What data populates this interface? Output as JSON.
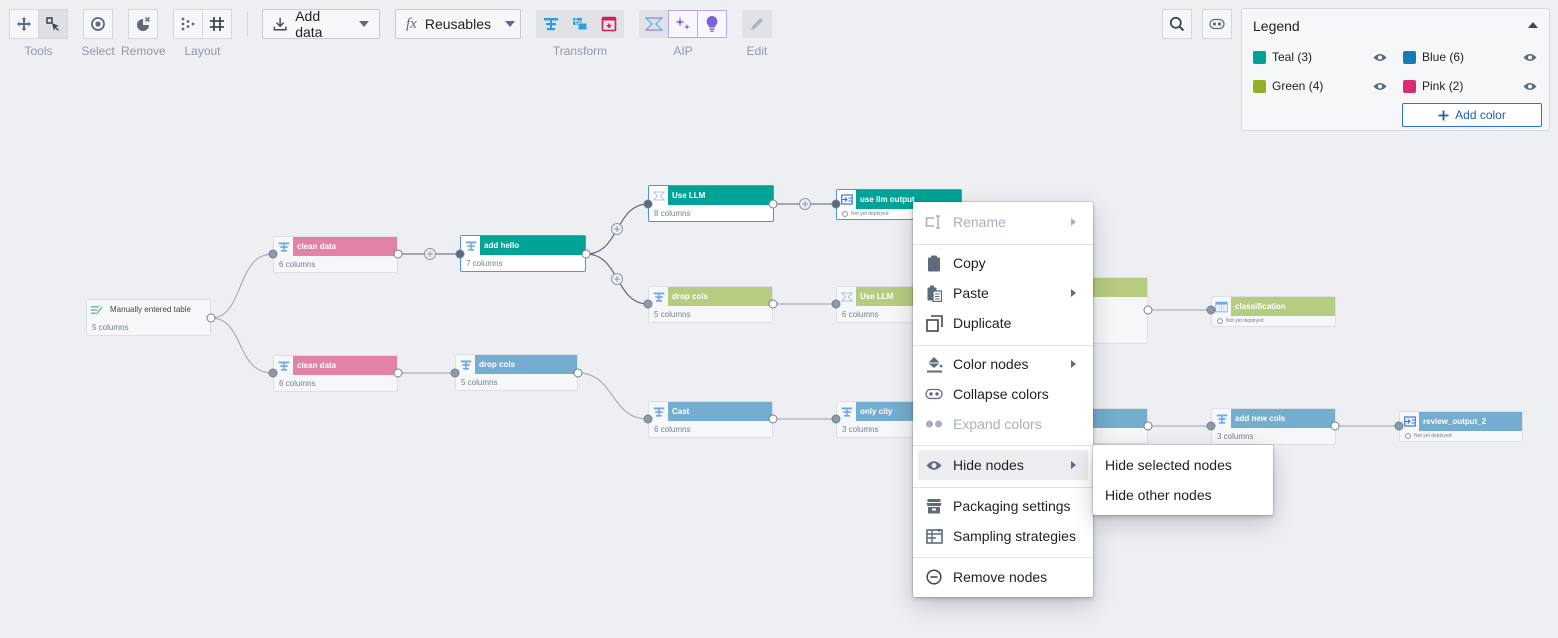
{
  "toolbar": {
    "groups": {
      "tools": "Tools",
      "select": "Select",
      "remove": "Remove",
      "layout": "Layout",
      "transform": "Transform",
      "aip": "AIP",
      "edit": "Edit"
    },
    "add_data": "Add data",
    "reusables": "Reusables",
    "reusables_prefix": "fx"
  },
  "legend": {
    "title": "Legend",
    "items": [
      {
        "label": "Teal",
        "count": "(3)",
        "color": "#00a396"
      },
      {
        "label": "Blue",
        "count": "(6)",
        "color": "#147eb3"
      },
      {
        "label": "Green",
        "count": "(4)",
        "color": "#8eb125"
      },
      {
        "label": "Pink",
        "count": "(2)",
        "color": "#db2c6f"
      }
    ],
    "add_color": "Add color"
  },
  "colors": {
    "teal_node": "#00a396",
    "pink_node": "#e283a5",
    "green_node": "#b6cc80",
    "blue_node": "#74adcf",
    "selection": "#4c90f0"
  },
  "nodes": [
    {
      "id": "manual",
      "title": "Manually entered table",
      "sub": "5 columns",
      "color": "plain",
      "icon": "manual-table-icon"
    },
    {
      "id": "clean1",
      "title": "clean data",
      "sub": "6 columns",
      "color": "pink",
      "icon": "transform-icon"
    },
    {
      "id": "clean2",
      "title": "clean data",
      "sub": "6 columns",
      "color": "pink",
      "icon": "transform-icon"
    },
    {
      "id": "addhello",
      "title": "add hello",
      "sub": "7 columns",
      "color": "teal",
      "icon": "transform-icon",
      "selected": true
    },
    {
      "id": "dropcols1",
      "title": "drop cols",
      "sub": "5 columns",
      "color": "blue",
      "icon": "transform-icon"
    },
    {
      "id": "usellm1",
      "title": "Use LLM",
      "sub": "8 columns",
      "color": "teal",
      "icon": "llm-icon",
      "selected": true
    },
    {
      "id": "dropcols2",
      "title": "drop cols",
      "sub": "5 columns",
      "color": "green",
      "icon": "transform-icon"
    },
    {
      "id": "usellmout",
      "title": "use llm output",
      "sub": "Not yet deployed",
      "color": "teal",
      "icon": "output-icon",
      "selected": true
    },
    {
      "id": "usellm2",
      "title": "Use LLM",
      "sub": "6 columns",
      "color": "green",
      "icon": "llm-icon"
    },
    {
      "id": "cast",
      "title": "Cast",
      "sub": "6 columns",
      "color": "blue",
      "icon": "transform-icon"
    },
    {
      "id": "onlycity",
      "title": "only city",
      "sub": "3 columns",
      "color": "blue",
      "icon": "transform-icon"
    },
    {
      "id": "classification",
      "title": "classification",
      "sub": "Not yet deployed",
      "color": "green",
      "icon": "dataset-icon"
    },
    {
      "id": "addnewcols",
      "title": "add new cols",
      "sub": "3 columns",
      "color": "blue",
      "icon": "transform-icon"
    },
    {
      "id": "review",
      "title": "review_output_2",
      "sub": "Not yet deployed",
      "color": "blue",
      "icon": "output-icon"
    }
  ],
  "context_menu": {
    "items": [
      {
        "label": "Rename",
        "icon": "rename-icon",
        "disabled": true,
        "submenu": true
      },
      {
        "label": "Copy",
        "icon": "clipboard-icon"
      },
      {
        "label": "Paste",
        "icon": "paste-icon",
        "submenu": true
      },
      {
        "label": "Duplicate",
        "icon": "duplicate-icon"
      },
      {
        "label": "Color nodes",
        "icon": "color-fill-icon",
        "submenu": true
      },
      {
        "label": "Collapse colors",
        "icon": "collapse-colors-icon"
      },
      {
        "label": "Expand colors",
        "icon": "expand-colors-icon",
        "disabled": true
      },
      {
        "label": "Hide nodes",
        "icon": "eye-icon",
        "submenu": true,
        "highlighted": true
      },
      {
        "label": "Packaging settings",
        "icon": "packaging-icon"
      },
      {
        "label": "Sampling strategies",
        "icon": "sampling-icon"
      },
      {
        "label": "Remove nodes",
        "icon": "remove-circle-icon"
      }
    ],
    "submenu": [
      "Hide selected nodes",
      "Hide other nodes"
    ]
  }
}
